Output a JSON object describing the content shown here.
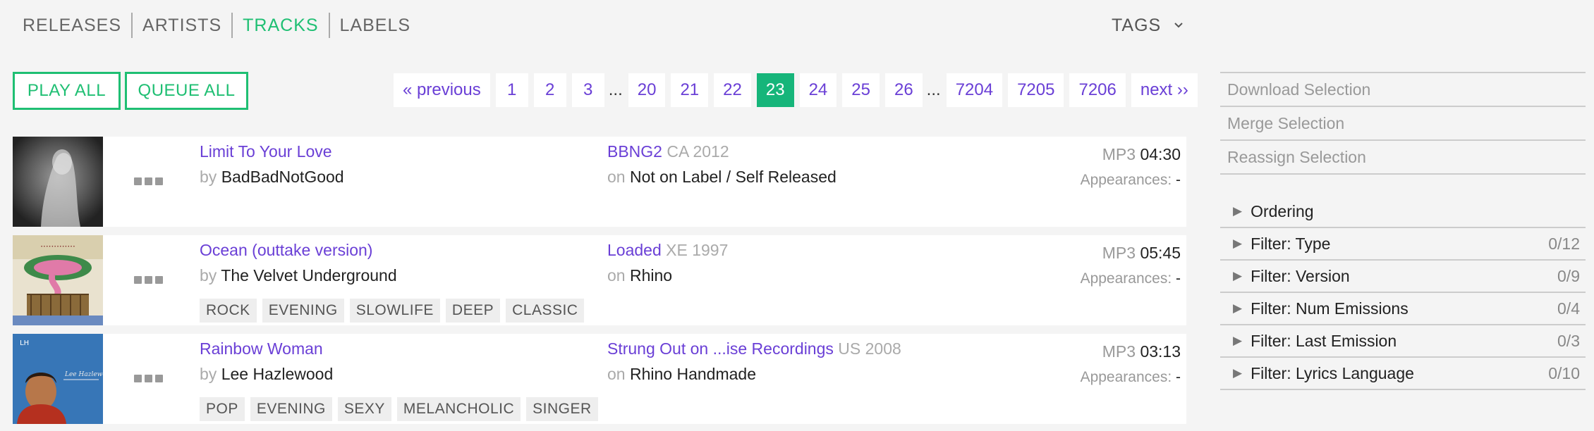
{
  "nav": {
    "items": [
      {
        "label": "RELEASES"
      },
      {
        "label": "ARTISTS"
      },
      {
        "label": "TRACKS"
      },
      {
        "label": "LABELS"
      }
    ],
    "active": "TRACKS",
    "tags_label": "TAGS"
  },
  "actions": {
    "play_all": "PLAY ALL",
    "queue_all": "QUEUE ALL"
  },
  "pager": {
    "previous": "« previous",
    "next": "next ››",
    "ellipsis": "...",
    "pages_a": [
      "1",
      "2",
      "3"
    ],
    "pages_b": [
      "20",
      "21",
      "22"
    ],
    "current": "23",
    "pages_c": [
      "24",
      "25",
      "26"
    ],
    "pages_d": [
      "7204",
      "7205",
      "7206"
    ]
  },
  "tracks": [
    {
      "title": "Limit To Your Love",
      "by_prefix": "by",
      "artist": "BadBadNotGood",
      "release": "BBNG2",
      "release_meta": "CA 2012",
      "on_prefix": "on",
      "label": "Not on Label / Self Released",
      "format": "MP3",
      "duration": "04:30",
      "appearances_label": "Appearances:",
      "appearances": "-",
      "tags": []
    },
    {
      "title": "Ocean (outtake version)",
      "by_prefix": "by",
      "artist": "The Velvet Underground",
      "release": "Loaded",
      "release_meta": "XE 1997",
      "on_prefix": "on",
      "label": "Rhino",
      "format": "MP3",
      "duration": "05:45",
      "appearances_label": "Appearances:",
      "appearances": "-",
      "tags": [
        "ROCK",
        "EVENING",
        "SLOWLIFE",
        "DEEP",
        "CLASSIC"
      ]
    },
    {
      "title": "Rainbow Woman",
      "by_prefix": "by",
      "artist": "Lee Hazlewood",
      "release": "Strung Out on ...ise Recordings",
      "release_meta": "US 2008",
      "on_prefix": "on",
      "label": "Rhino Handmade",
      "format": "MP3",
      "duration": "03:13",
      "appearances_label": "Appearances:",
      "appearances": "-",
      "tags": [
        "POP",
        "EVENING",
        "SEXY",
        "MELANCHOLIC",
        "SINGER"
      ]
    }
  ],
  "sidebar": {
    "actions": [
      "Download Selection",
      "Merge Selection",
      "Reassign Selection"
    ],
    "filters": [
      {
        "label": "Ordering",
        "count": ""
      },
      {
        "label": "Filter: Type",
        "count": "0/12"
      },
      {
        "label": "Filter: Version",
        "count": "0/9"
      },
      {
        "label": "Filter: Num Emissions",
        "count": "0/4"
      },
      {
        "label": "Filter: Last Emission",
        "count": "0/3"
      },
      {
        "label": "Filter: Lyrics Language",
        "count": "0/10"
      }
    ]
  },
  "colors": {
    "accent": "#1fbf73",
    "link": "#6a3fd6",
    "current_page": "#16b57a"
  },
  "icons": {
    "expand": "triangle-right-icon",
    "tags_toggle": "chevron-down-icon",
    "more": "more-dots-icon"
  }
}
